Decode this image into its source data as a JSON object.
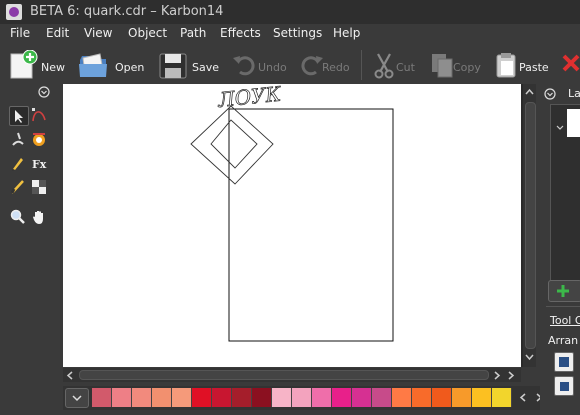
{
  "window": {
    "title": "BETA 6: quark.cdr – Karbon14"
  },
  "menu": [
    "File",
    "Edit",
    "View",
    "Object",
    "Path",
    "Effects",
    "Settings",
    "Help"
  ],
  "toolbar": {
    "new": "New",
    "open": "Open",
    "save": "Save",
    "undo": "Undo",
    "redo": "Redo",
    "cut": "Cut",
    "copy": "Copy",
    "paste": "Paste"
  },
  "canvas": {
    "text_art": "ЛОУК"
  },
  "docker": {
    "layers_tab": "La",
    "tool_options": "Tool O",
    "arrange": "Arran"
  },
  "palette": {
    "colors": [
      "#d25a6b",
      "#ee7f86",
      "#f28a7d",
      "#f2906f",
      "#f59a7a",
      "#e01025",
      "#c81630",
      "#a51e2b",
      "#8b1020",
      "#f7b4c7",
      "#f3a3be",
      "#ef6eaa",
      "#e8208a",
      "#d63092",
      "#c74b8a",
      "#ff7a45",
      "#f86b2a",
      "#f05a1c",
      "#f79a2a",
      "#fcc021",
      "#f2d52c"
    ]
  },
  "colors": {
    "accent_add": "#3cb84a",
    "close_red": "#e03030"
  }
}
